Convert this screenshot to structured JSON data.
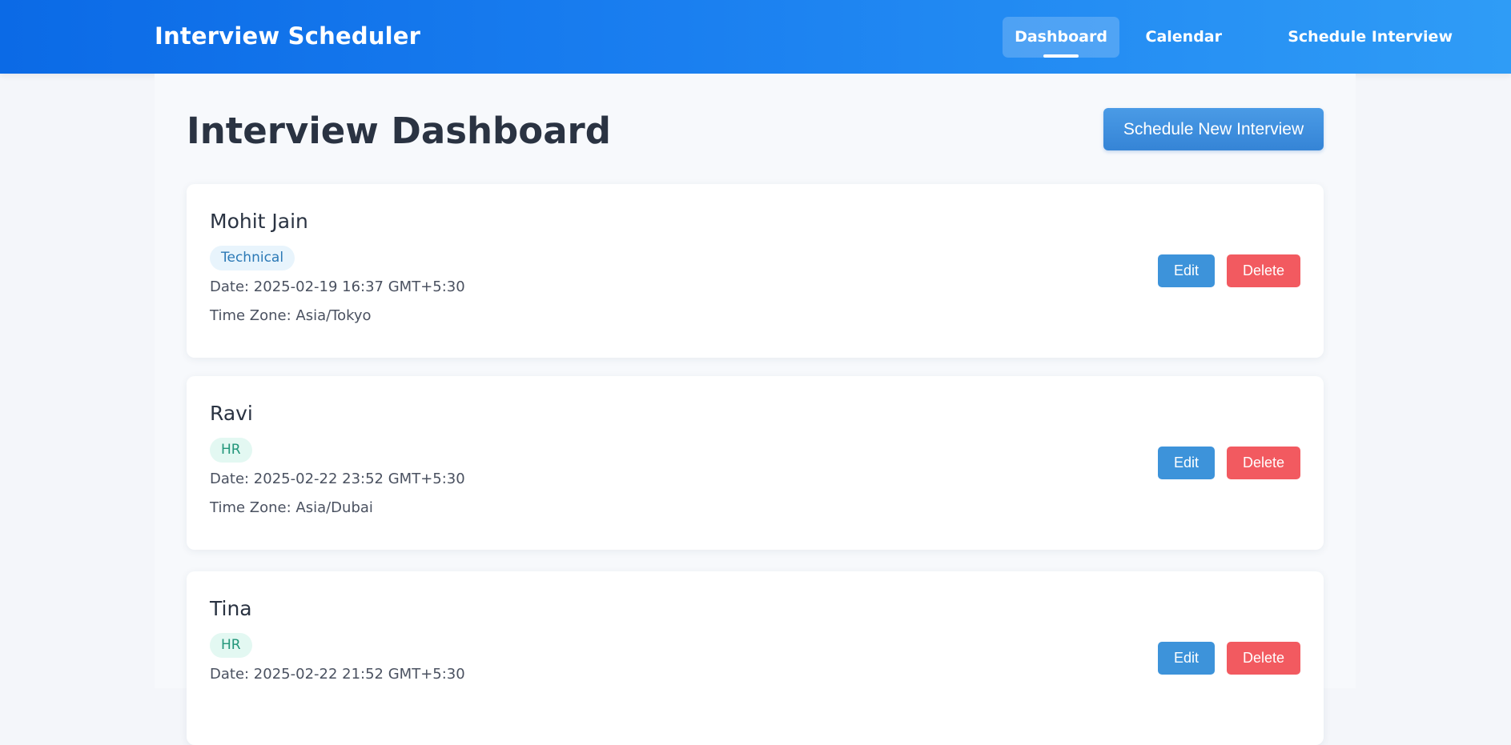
{
  "app": {
    "title": "Interview Scheduler"
  },
  "nav": {
    "items": [
      {
        "label": "Dashboard",
        "active": true
      },
      {
        "label": "Calendar",
        "active": false
      },
      {
        "label": "Schedule Interview",
        "active": false
      }
    ]
  },
  "page": {
    "title": "Interview Dashboard",
    "primary_action": "Schedule New Interview"
  },
  "interviews": [
    {
      "name": "Mohit Jain",
      "type": "Technical",
      "date": "Date: 2025-02-19 16:37 GMT+5:30",
      "timezone": "Time Zone: Asia/Tokyo",
      "edit_label": "Edit",
      "delete_label": "Delete"
    },
    {
      "name": "Ravi",
      "type": "HR",
      "date": "Date: 2025-02-22 23:52 GMT+5:30",
      "timezone": "Time Zone: Asia/Dubai",
      "edit_label": "Edit",
      "delete_label": "Delete"
    },
    {
      "name": "Tina",
      "type": "HR",
      "date": "Date: 2025-02-22 21:52 GMT+5:30",
      "timezone": "",
      "edit_label": "Edit",
      "delete_label": "Delete"
    }
  ],
  "colors": {
    "nav_start": "#0b6ae6",
    "nav_end": "#2f9cf6",
    "primary": "#3d93da",
    "danger": "#f25a60",
    "badge_technical_text": "#2b79b6",
    "badge_hr_text": "#22967a"
  }
}
